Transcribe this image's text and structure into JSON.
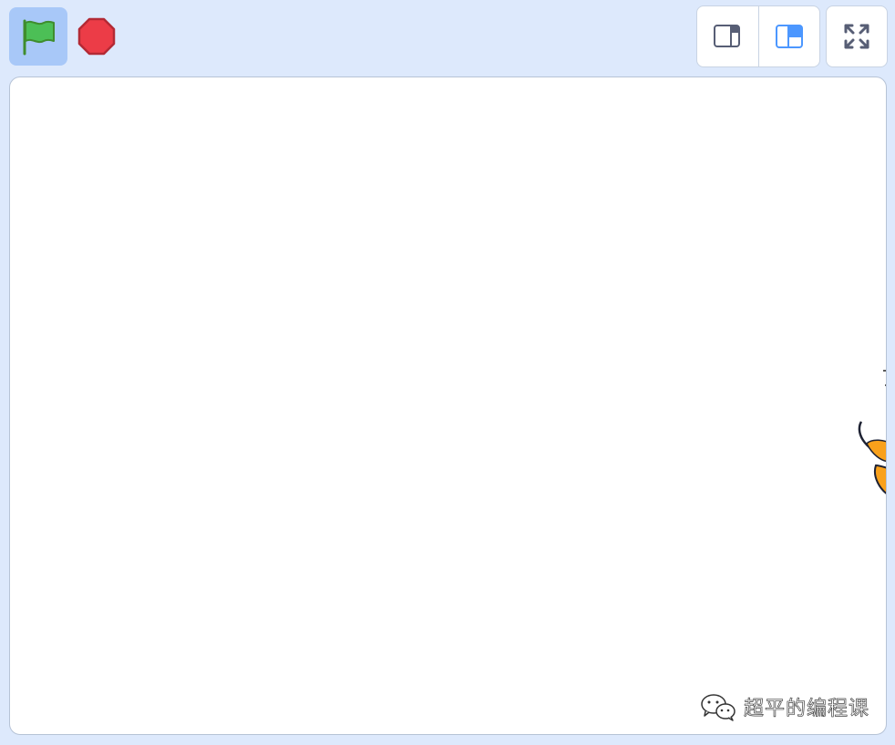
{
  "toolbar": {
    "green_flag_icon": "green-flag-icon",
    "stop_icon": "stop-sign-icon",
    "small_stage_icon": "small-stage-icon",
    "large_stage_icon": "large-stage-icon",
    "fullscreen_icon": "fullscreen-icon",
    "active_mode": "large-stage"
  },
  "stage": {
    "watermark_icon": "wechat-icon",
    "watermark_text": "超平的编程课"
  },
  "colors": {
    "background": "#dde9fc",
    "flag_button_active": "#a8c8f8",
    "flag_green": "#4cbf56",
    "stop_red": "#ec3c47",
    "mode_active_blue": "#4c97ff",
    "icon_gray": "#575e75",
    "sprite_orange": "#f9a11b"
  }
}
